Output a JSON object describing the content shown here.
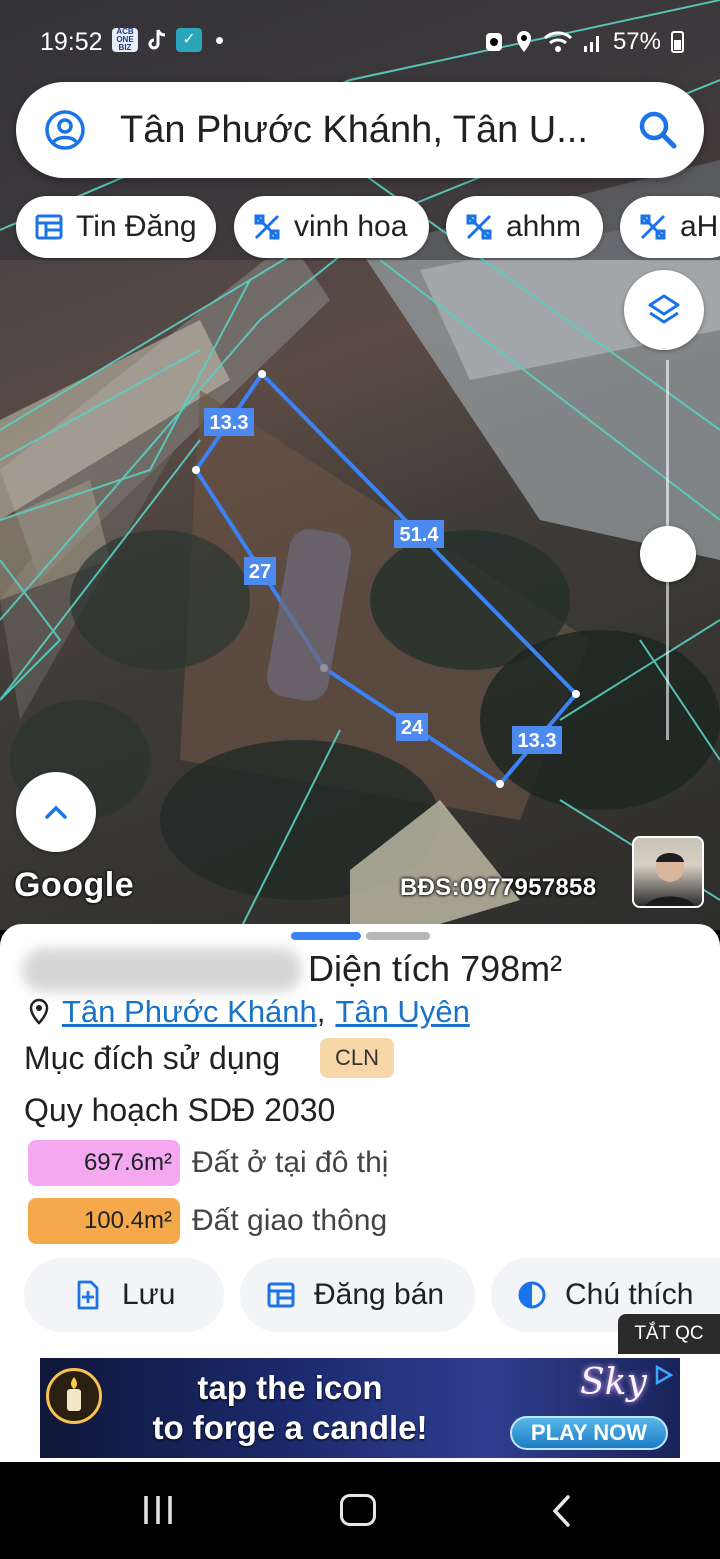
{
  "status_bar": {
    "time": "19:52",
    "acb_icon_text": "ACB ONE BIZ",
    "battery": "57%"
  },
  "search": {
    "query": "Tân Phước Khánh, Tân U..."
  },
  "chips": [
    {
      "label": "Tin Đăng",
      "icon": "calendar-icon"
    },
    {
      "label": "vinh hoa",
      "icon": "crosshatch-icon"
    },
    {
      "label": "ahhm",
      "icon": "crosshatch-icon"
    },
    {
      "label": "aH",
      "icon": "crosshatch-icon"
    }
  ],
  "map": {
    "edge_labels": [
      "13.3",
      "51.4",
      "27",
      "24",
      "13.3"
    ],
    "google_logo": "Google",
    "watermark": "BĐS:0977957858"
  },
  "sheet": {
    "area_label": "Diện tích",
    "area_value": "798m²",
    "location_part1": "Tân Phước Khánh",
    "location_sep": ",",
    "location_part2": "Tân Uyên",
    "purpose_label": "Mục đích sử dụng",
    "purpose_code": "CLN",
    "plan_title": "Quy hoạch SDĐ 2030",
    "legend": [
      {
        "value": "697.6m²",
        "label": "Đất ở tại đô thị",
        "color": "#f3a8f0"
      },
      {
        "value": "100.4m²",
        "label": "Đất giao thông",
        "color": "#f5a94a"
      }
    ],
    "actions": [
      {
        "label": "Lưu",
        "icon": "bookmark-plus-icon"
      },
      {
        "label": "Đăng bán",
        "icon": "calendar-icon"
      },
      {
        "label": "Chú thích",
        "icon": "half-circle-icon"
      }
    ]
  },
  "ad": {
    "close_label": "TẮT QC",
    "headline": "tap the icon to forge a candle!",
    "cta": "PLAY NOW",
    "brand": "Sky"
  },
  "colors": {
    "accent": "#1a73e8",
    "plot_outline": "#3b82f6",
    "parcel_lines": "#5ad0c2"
  }
}
